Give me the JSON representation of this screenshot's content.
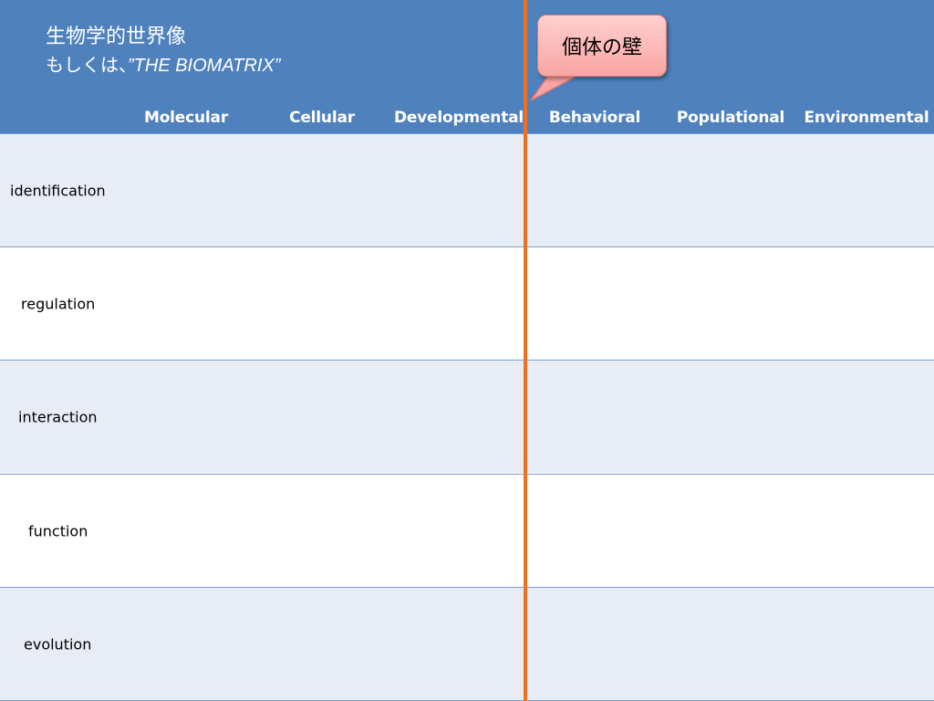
{
  "header": {
    "title_line1": "生物学的世界像",
    "title_line2_prefix": "もしくは、",
    "title_line2_en": "”THE BIOMATRIX”"
  },
  "columns": [
    "Molecular",
    "Cellular",
    "Developmental",
    "Behavioral",
    "Populational",
    "Environmental"
  ],
  "rows": [
    "identification",
    "regulation",
    "interaction",
    "function",
    "evolution"
  ],
  "callout": {
    "text": "個体の壁"
  },
  "colors": {
    "header_bg": "#4f81bd",
    "row_shade": "#e8edf5",
    "divider": "#ee7023",
    "callout_fill": "#f8a5a3"
  }
}
